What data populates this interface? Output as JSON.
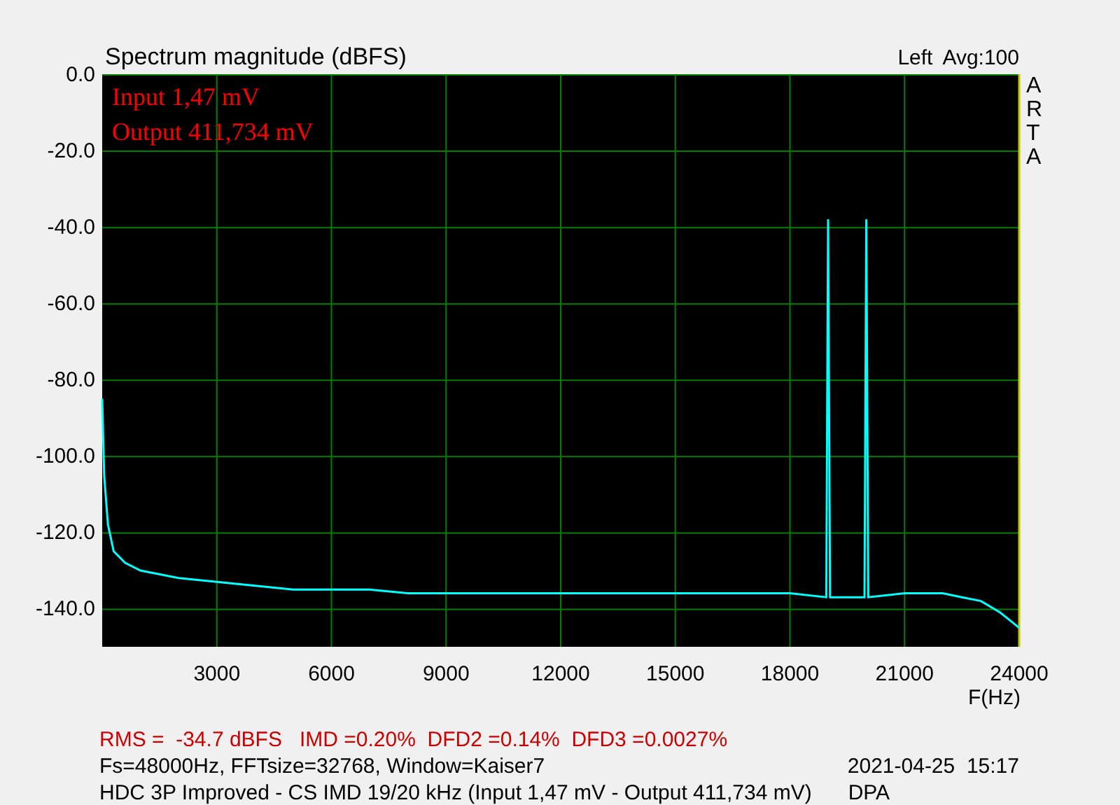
{
  "chart": {
    "average": "Avg:100",
    "side_label": "ARTA",
    "overlay_lines": [
      "Input 1,47 mV",
      "Output 411,734 mV"
    ],
    "chart_data": {
      "type": "line",
      "title": "Spectrum magnitude (dBFS)",
      "xlabel": "F(Hz)",
      "grid": true,
      "xlim": [
        0,
        24000
      ],
      "ylim": [
        -150,
        0
      ],
      "xticks": [
        3000,
        6000,
        9000,
        12000,
        15000,
        18000,
        21000,
        24000
      ],
      "yticks": [
        {
          "value": 0,
          "label": "0.0"
        },
        {
          "value": -20,
          "label": "-20.0"
        },
        {
          "value": -40,
          "label": "-40.0"
        },
        {
          "value": -60,
          "label": "-60.0"
        },
        {
          "value": -80,
          "label": "-80.0"
        },
        {
          "value": -100,
          "label": "-100.0"
        },
        {
          "value": -120,
          "label": "-120.0"
        },
        {
          "value": -140,
          "label": "-140.0"
        }
      ],
      "x": [
        0,
        50,
        150,
        300,
        600,
        1000,
        2000,
        3000,
        4000,
        5000,
        6000,
        7000,
        8000,
        9000,
        10000,
        11000,
        12000,
        13000,
        14000,
        15000,
        16000,
        17000,
        18000,
        18950,
        19000,
        19050,
        19950,
        20000,
        20050,
        21000,
        22000,
        22500,
        23000,
        23500,
        24000
      ],
      "series": [
        {
          "name": "Left",
          "color": "#00ffff",
          "values": [
            -85,
            -105,
            -118,
            -125,
            -128,
            -130,
            -132,
            -133,
            -134,
            -135,
            -135,
            -135,
            -136,
            -136,
            -136,
            -136,
            -136,
            -136,
            -136,
            -136,
            -136,
            -136,
            -136,
            -137,
            -38,
            -137,
            -137,
            -38,
            -137,
            -136,
            -136,
            -137,
            -138,
            -141,
            -145
          ]
        }
      ]
    }
  },
  "measurements": "RMS =  -34.7 dBFS   IMD =0.20%  DFD2 =0.14%  DFD3 =0.0027%",
  "settings": "Fs=48000Hz, FFTsize=32768, Window=Kaiser7",
  "timestamp": "2021-04-25  15:17",
  "description": "HDC 3P Improved - CS IMD 19/20 kHz (Input 1,47 mV - Output 411,734 mV)",
  "tag": "DPA"
}
